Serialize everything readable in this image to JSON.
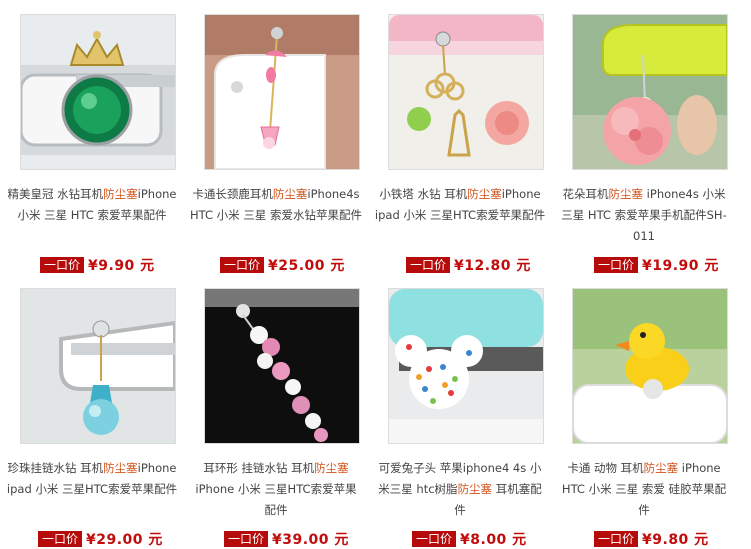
{
  "products": [
    {
      "pre": "精美皇冠 水钻耳机",
      "kw": "防尘塞",
      "post": "iPhone 小米 三星 HTC 索爱苹果配件",
      "price_label": "一口价",
      "price": "¥9.90 元",
      "image_icon": "crown-emerald-plug-icon"
    },
    {
      "pre": "卡通长颈鹿耳机",
      "kw": "防尘塞",
      "post": "iPhone4s HTC 小米 三星 索爱水钻苹果配件",
      "price_label": "一口价",
      "price": "¥25.00 元",
      "image_icon": "giraffe-chain-plug-icon"
    },
    {
      "pre": "小铁塔 水钻 耳机",
      "kw": "防尘塞",
      "post": "iPhone ipad 小米 三星HTC索爱苹果配件",
      "price_label": "一口价",
      "price": "¥12.80 元",
      "image_icon": "eiffel-tower-plug-icon"
    },
    {
      "pre": "花朵耳机",
      "kw": "防尘塞",
      "post": " iPhone4s 小米 三星 HTC 索爱苹果手机配件SH-011",
      "price_label": "一口价",
      "price": "¥19.90 元",
      "image_icon": "pink-flower-plug-icon"
    },
    {
      "pre": "珍珠挂链水钻 耳机",
      "kw": "防尘塞",
      "post": "iPhone ipad 小米 三星HTC索爱苹果配件",
      "price_label": "一口价",
      "price": "¥29.00 元",
      "image_icon": "pearl-drop-plug-icon"
    },
    {
      "pre": "耳环形 挂链水钻 耳机",
      "kw": "防尘塞",
      "post": "iPhone 小米 三星HTC索爱苹果配件",
      "price_label": "一口价",
      "price": "¥39.00 元",
      "image_icon": "crystal-flower-chain-plug-icon"
    },
    {
      "pre": "可爱兔子头 苹果iphone4 4s 小米三星 htc树脂",
      "kw": "防尘塞",
      "post": " 耳机塞配件",
      "price_label": "一口价",
      "price": "¥8.00 元",
      "image_icon": "polka-dot-mouse-plug-icon"
    },
    {
      "pre": "卡通 动物 耳机",
      "kw": "防尘塞",
      "post": " iPhone HTC 小米 三星 索爱 硅胶苹果配件",
      "price_label": "一口价",
      "price": "¥9.80 元",
      "image_icon": "yellow-duck-plug-icon"
    }
  ]
}
